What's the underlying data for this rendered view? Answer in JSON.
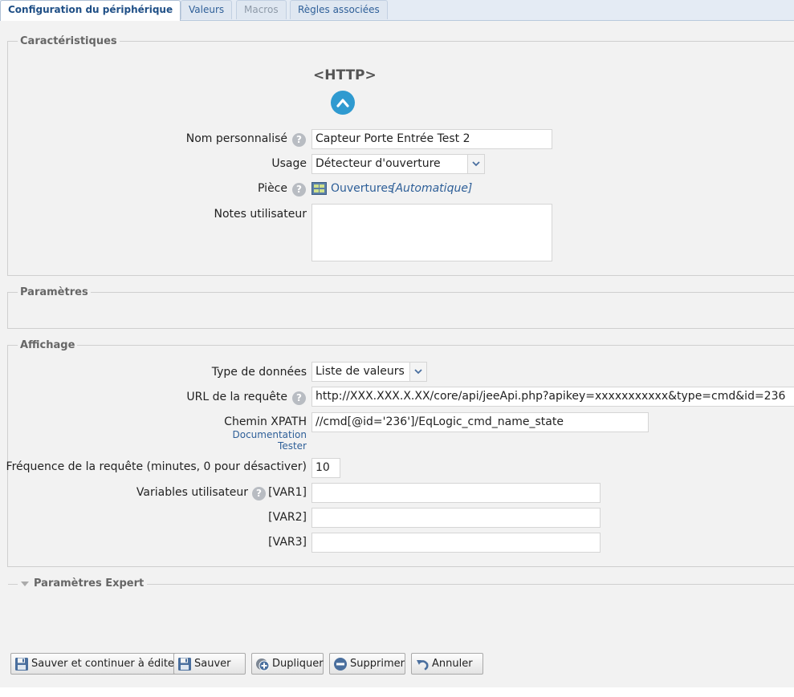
{
  "tabs": [
    {
      "label": "Configuration du périphérique",
      "state": "active"
    },
    {
      "label": "Valeurs",
      "state": "normal"
    },
    {
      "label": "Macros",
      "state": "disabled"
    },
    {
      "label": "Règles associées",
      "state": "normal"
    }
  ],
  "caracteristiques": {
    "legend": "Caractéristiques",
    "device_type": "<HTTP>",
    "nom_label": "Nom personnalisé",
    "nom_value": "Capteur Porte Entrée Test 2",
    "usage_label": "Usage",
    "usage_value": "Détecteur d'ouverture",
    "piece_label": "Pièce",
    "piece_name": "Ouvertures",
    "piece_mode": "[Automatique]",
    "notes_label": "Notes utilisateur",
    "notes_value": ""
  },
  "parametres": {
    "legend": "Paramètres"
  },
  "affichage": {
    "legend": "Affichage",
    "type_label": "Type de données",
    "type_value": "Liste de valeurs",
    "url_label": "URL de la requête",
    "url_value": "http://XXX.XXX.X.XX/core/api/jeeApi.php?apikey=xxxxxxxxxxx&type=cmd&id=236",
    "xpath_label": "Chemin XPATH",
    "xpath_value": "//cmd[@id='236']/EqLogic_cmd_name_state",
    "doc_link": "Documentation",
    "tester_link": "Tester",
    "freq_label": "Fréquence de la requête (minutes, 0 pour désactiver)",
    "freq_value": "10",
    "vars_label": "Variables utilisateur",
    "vars": [
      {
        "label": "[VAR1]",
        "value": ""
      },
      {
        "label": "[VAR2]",
        "value": ""
      },
      {
        "label": "[VAR3]",
        "value": ""
      }
    ]
  },
  "expert": {
    "legend": "Paramètres Expert"
  },
  "buttons": {
    "save_continue": "Sauver et continuer à éditer",
    "save": "Sauver",
    "duplicate": "Dupliquer",
    "delete": "Supprimer",
    "cancel": "Annuler"
  },
  "icons": {
    "help": "question-icon",
    "collapse": "chevron-up-icon",
    "room": "room-icon",
    "save": "floppy-disk-icon",
    "duplicate": "duplicate-icon",
    "delete": "minus-circle-icon",
    "cancel": "undo-icon"
  },
  "colors": {
    "accent": "#2f9ad0",
    "link": "#2e5f98",
    "panel_bg": "#f2f2f2"
  }
}
